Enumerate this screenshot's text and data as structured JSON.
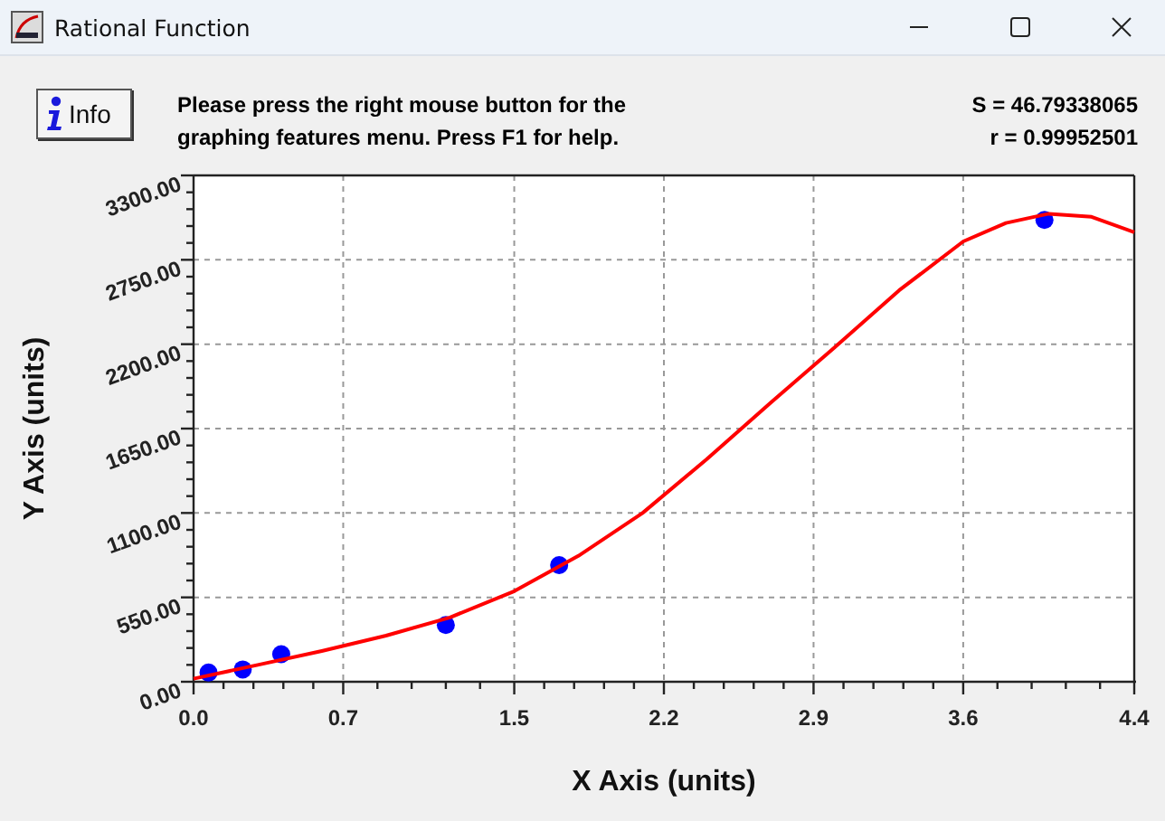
{
  "window": {
    "title": "Rational Function"
  },
  "toolbar": {
    "info_button": "Info",
    "message": "Please press the right mouse button for the graphing features menu.  Press F1 for help.",
    "stats": [
      "S = 46.79338065",
      "r = 0.99952501"
    ]
  },
  "graph": {
    "chart_data": {
      "type": "scatter",
      "xlabel": "X Axis (units)",
      "ylabel": "Y Axis (units)",
      "xlim": [
        0,
        4.4
      ],
      "ylim": [
        0,
        3300
      ],
      "grid": true,
      "xticks": [
        {
          "value": 0,
          "label": "0.0"
        },
        {
          "value": 0.7,
          "label": "0.7"
        },
        {
          "value": 1.5,
          "label": "1.5"
        },
        {
          "value": 2.2,
          "label": "2.2"
        },
        {
          "value": 2.9,
          "label": "2.9"
        },
        {
          "value": 3.6,
          "label": "3.6"
        },
        {
          "value": 4.4,
          "label": "4.4"
        }
      ],
      "yticks": [
        {
          "value": 0,
          "label": "0.00"
        },
        {
          "value": 550,
          "label": "550.00"
        },
        {
          "value": 1100,
          "label": "1100.00"
        },
        {
          "value": 1650,
          "label": "1650.00"
        },
        {
          "value": 2200,
          "label": "2200.00"
        },
        {
          "value": 2750,
          "label": "2750.00"
        },
        {
          "value": 3300,
          "label": "3300.00"
        }
      ],
      "series": [
        {
          "type": "scatter",
          "color": "#0000ff",
          "x": [
            0.07,
            0.23,
            0.41,
            1.18,
            1.71,
            3.98
          ],
          "values": [
            60,
            80,
            180,
            370,
            760,
            3010
          ]
        },
        {
          "type": "line",
          "color": "#ff0000",
          "x": [
            0,
            0.3,
            0.6,
            0.9,
            1.2,
            1.5,
            1.8,
            2.1,
            2.4,
            2.7,
            3.0,
            3.3,
            3.6,
            3.8,
            4.0,
            4.2,
            4.4
          ],
          "values": [
            20,
            110,
            200,
            300,
            420,
            590,
            820,
            1100,
            1450,
            1820,
            2180,
            2550,
            2870,
            2990,
            3050,
            3030,
            2930
          ]
        }
      ]
    }
  }
}
